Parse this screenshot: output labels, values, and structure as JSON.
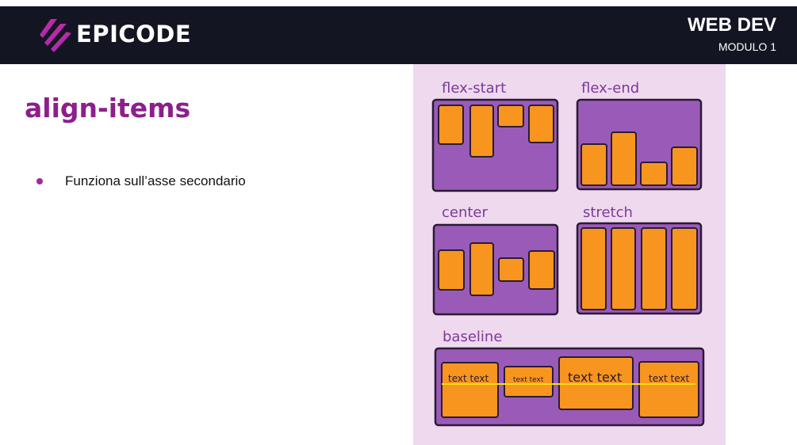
{
  "header": {
    "brand": "EPICODE",
    "course_title": "WEB DEV",
    "module": "MODULO 1"
  },
  "slide": {
    "title": "align-items",
    "bullets": [
      "Funziona sull’asse secondario"
    ]
  },
  "illustration": {
    "panels": [
      {
        "label": "flex-start",
        "alignment": "flex-start"
      },
      {
        "label": "flex-end",
        "alignment": "flex-end"
      },
      {
        "label": "center",
        "alignment": "center"
      },
      {
        "label": "stretch",
        "alignment": "stretch"
      },
      {
        "label": "baseline",
        "alignment": "baseline",
        "item_texts": [
          "text text",
          "text text",
          "text text",
          "text text"
        ]
      }
    ],
    "colors": {
      "background": "#efd9ef",
      "container": "#9a5bb8",
      "item": "#f7951e",
      "label": "#7b3a99",
      "baseline_line": "#f5df14"
    }
  },
  "colors": {
    "header_bg": "#131522",
    "title": "#8e1e8c",
    "bullet": "#a02a9c",
    "logo_gradient": [
      "#e8208b",
      "#7a2ad1"
    ]
  },
  "icons": {
    "logo": "epicode-logo-icon"
  }
}
